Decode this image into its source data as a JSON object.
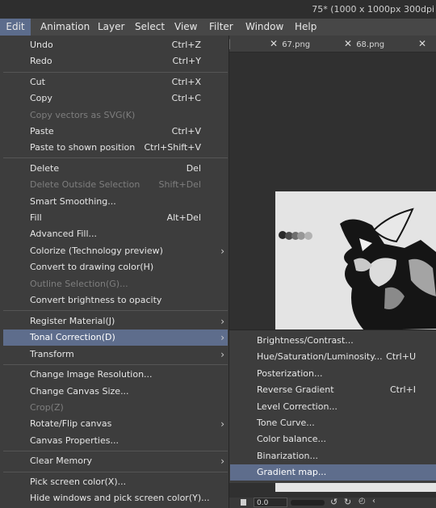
{
  "title_text": "75* (1000 x 1000px 300dpi",
  "menubar": [
    "Edit",
    "Animation",
    "Layer",
    "Select",
    "View",
    "Filter",
    "Window",
    "Help"
  ],
  "tabs": [
    "67.png",
    "68.png"
  ],
  "zoom": "0.0",
  "edit_menu": [
    {
      "label": "Undo",
      "shortcut": "Ctrl+Z"
    },
    {
      "label": "Redo",
      "shortcut": "Ctrl+Y"
    },
    {
      "label": "Cut",
      "shortcut": "Ctrl+X"
    },
    {
      "label": "Copy",
      "shortcut": "Ctrl+C"
    },
    {
      "label": "Copy vectors as SVG(K)",
      "shortcut": ""
    },
    {
      "label": "Paste",
      "shortcut": "Ctrl+V"
    },
    {
      "label": "Paste to shown position",
      "shortcut": "Ctrl+Shift+V"
    },
    {
      "label": "Delete",
      "shortcut": "Del"
    },
    {
      "label": "Delete Outside Selection",
      "shortcut": "Shift+Del"
    },
    {
      "label": "Smart Smoothing...",
      "shortcut": ""
    },
    {
      "label": "Fill",
      "shortcut": "Alt+Del"
    },
    {
      "label": "Advanced Fill...",
      "shortcut": ""
    },
    {
      "label": "Colorize (Technology preview)",
      "shortcut": ""
    },
    {
      "label": "Convert to drawing color(H)",
      "shortcut": ""
    },
    {
      "label": "Outline Selection(G)...",
      "shortcut": ""
    },
    {
      "label": "Convert brightness to opacity",
      "shortcut": ""
    },
    {
      "label": "Register Material(J)",
      "shortcut": ""
    },
    {
      "label": "Tonal Correction(D)",
      "shortcut": ""
    },
    {
      "label": "Transform",
      "shortcut": ""
    },
    {
      "label": "Change Image Resolution...",
      "shortcut": ""
    },
    {
      "label": "Change Canvas Size...",
      "shortcut": ""
    },
    {
      "label": "Crop(Z)",
      "shortcut": ""
    },
    {
      "label": "Rotate/Flip canvas",
      "shortcut": ""
    },
    {
      "label": "Canvas Properties...",
      "shortcut": ""
    },
    {
      "label": "Clear Memory",
      "shortcut": ""
    },
    {
      "label": "Pick screen color(X)...",
      "shortcut": ""
    },
    {
      "label": "Hide windows and pick screen color(Y)...",
      "shortcut": ""
    }
  ],
  "tonal_submenu": [
    {
      "label": "Brightness/Contrast...",
      "shortcut": ""
    },
    {
      "label": "Hue/Saturation/Luminosity...",
      "shortcut": "Ctrl+U"
    },
    {
      "label": "Posterization...",
      "shortcut": ""
    },
    {
      "label": "Reverse Gradient",
      "shortcut": "Ctrl+I"
    },
    {
      "label": "Level Correction...",
      "shortcut": ""
    },
    {
      "label": "Tone Curve...",
      "shortcut": ""
    },
    {
      "label": "Color balance...",
      "shortcut": ""
    },
    {
      "label": "Binarization...",
      "shortcut": ""
    },
    {
      "label": "Gradient map...",
      "shortcut": ""
    }
  ],
  "colors": {
    "highlight": "#5e6d8c",
    "menu_bg": "#3d3d3d",
    "disabled": "#7e7e7e"
  }
}
